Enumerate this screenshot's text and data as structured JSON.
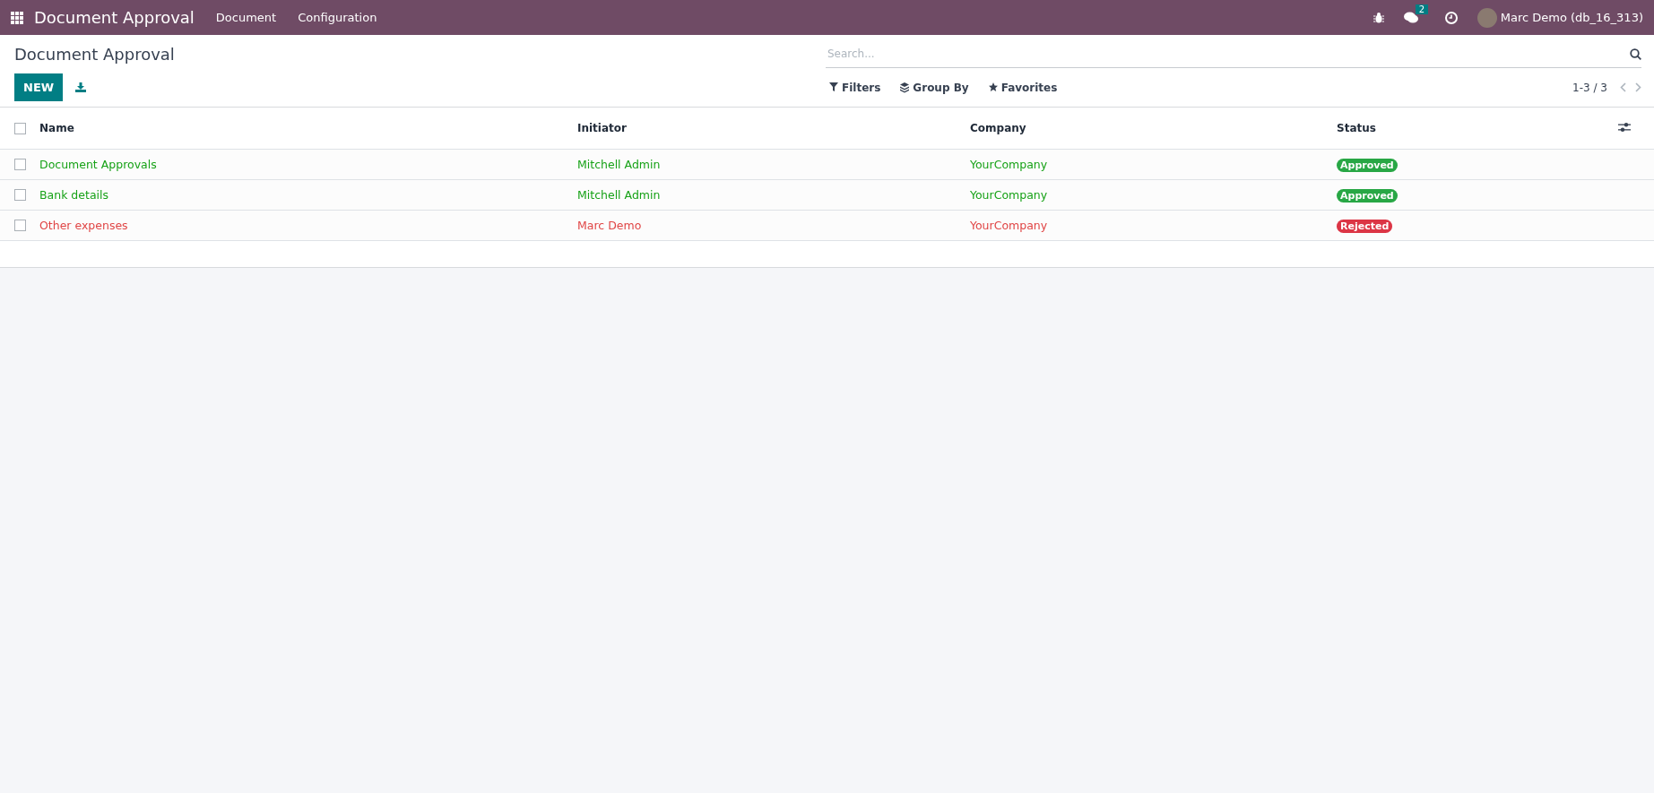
{
  "navbar": {
    "app_name": "Document Approval",
    "menu": [
      "Document",
      "Configuration"
    ],
    "message_count": "2",
    "user": "Marc Demo (db_16_313)"
  },
  "control_panel": {
    "breadcrumb": "Document Approval",
    "new_button": "NEW",
    "search": {
      "placeholder": "Search..."
    },
    "filters": [
      "Filters",
      "Group By",
      "Favorites"
    ],
    "pager": "1-3 / 3"
  },
  "table": {
    "select_all_checked": false,
    "columns": [
      "Name",
      "Initiator",
      "Company",
      "Status"
    ],
    "rows": [
      {
        "checked": false,
        "name": "Document Approvals",
        "initiator": "Mitchell Admin",
        "company": "YourCompany",
        "status": {
          "label": "Approved",
          "kind": "approved"
        }
      },
      {
        "checked": false,
        "name": "Bank details",
        "initiator": "Mitchell Admin",
        "company": "YourCompany",
        "status": {
          "label": "Approved",
          "kind": "approved"
        }
      },
      {
        "checked": false,
        "name": "Other expenses",
        "initiator": "Marc Demo",
        "company": "YourCompany",
        "status": {
          "label": "Rejected",
          "kind": "rejected"
        }
      }
    ]
  }
}
